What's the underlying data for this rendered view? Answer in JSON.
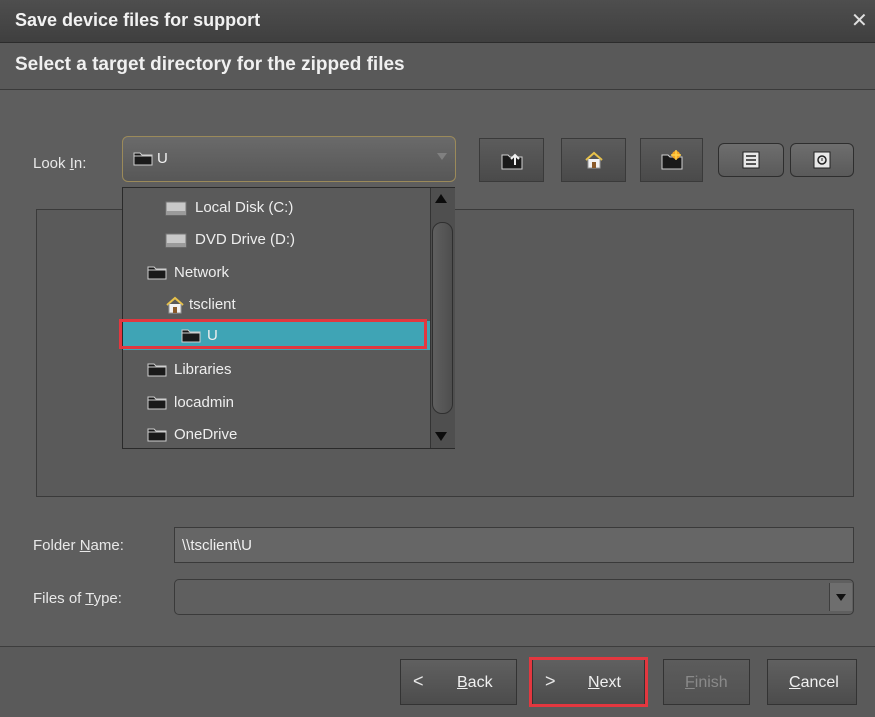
{
  "window": {
    "title": "Save device files for support"
  },
  "header": {
    "subtitle": "Select a target directory for the zipped files"
  },
  "look_in": {
    "label_pre": "Look ",
    "label_mnemonic": "I",
    "label_post": "n:",
    "selected": "U"
  },
  "dropdown": {
    "items": [
      {
        "label": "Local Disk (C:)",
        "icon": "drive-icon",
        "level": 2
      },
      {
        "label": "DVD Drive (D:)",
        "icon": "drive-icon",
        "level": 2
      },
      {
        "label": "Network",
        "icon": "folder-icon",
        "level": 1
      },
      {
        "label": "tsclient",
        "icon": "home-icon",
        "level": 2
      },
      {
        "label": "U",
        "icon": "folder-icon",
        "level": 3,
        "selected": true
      },
      {
        "label": "Libraries",
        "icon": "folder-icon",
        "level": 1
      },
      {
        "label": "locadmin",
        "icon": "folder-icon",
        "level": 1
      },
      {
        "label": "OneDrive",
        "icon": "folder-icon",
        "level": 1
      }
    ]
  },
  "toolbar": {
    "icons": [
      "up-folder-icon",
      "home-icon",
      "new-folder-icon",
      "list-view-icon",
      "details-view-icon"
    ]
  },
  "folder_name": {
    "label_pre": "Folder ",
    "label_mnemonic": "N",
    "label_post": "ame:",
    "value": "\\\\tsclient\\U"
  },
  "files_of_type": {
    "label_pre": "Files of ",
    "label_mnemonic": "T",
    "label_post": "ype:",
    "value": ""
  },
  "buttons": {
    "back": {
      "mnemonic": "B",
      "rest": "ack"
    },
    "next": {
      "mnemonic": "N",
      "rest": "ext"
    },
    "finish": {
      "mnemonic": "F",
      "rest": "inish"
    },
    "cancel": {
      "mnemonic": "C",
      "rest": "ancel"
    }
  },
  "colors": {
    "selection": "#3fa4b5",
    "highlight_border": "#e3373f",
    "background": "#5e5e5e"
  }
}
